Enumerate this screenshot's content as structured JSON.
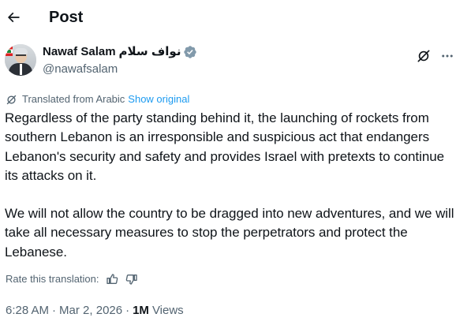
{
  "header": {
    "title": "Post"
  },
  "author": {
    "display_name": "Nawaf Salam",
    "display_name_arabic": "نواف سلام",
    "handle": "@nawafsalam"
  },
  "translation": {
    "label": "Translated from Arabic",
    "show_original": "Show original"
  },
  "post": {
    "paragraph_1": "Regardless of the party standing behind it, the launching of rockets from southern Lebanon is an irresponsible and suspicious act that endangers Lebanon's security and safety and provides Israel with pretexts to continue its attacks on it.",
    "paragraph_2": "We will not allow the country to be dragged into new adventures, and we will take all necessary measures to stop the perpetrators and protect the Lebanese."
  },
  "rating": {
    "label": "Rate this translation:"
  },
  "meta": {
    "time": "6:28 AM",
    "separator": "·",
    "date": "Mar 2, 2026",
    "views_count": "1M",
    "views_label": "Views"
  },
  "colors": {
    "text_primary": "#0f1419",
    "text_secondary": "#536471",
    "link": "#1d9bf0",
    "verified_badge": "#829aab"
  },
  "icons": {
    "back": "arrow-left-icon",
    "verified": "verified-badge-icon",
    "grok": "grok-icon",
    "more": "more-icon",
    "translate": "translate-icon",
    "thumbs_up": "thumbs-up-icon",
    "thumbs_down": "thumbs-down-icon"
  }
}
